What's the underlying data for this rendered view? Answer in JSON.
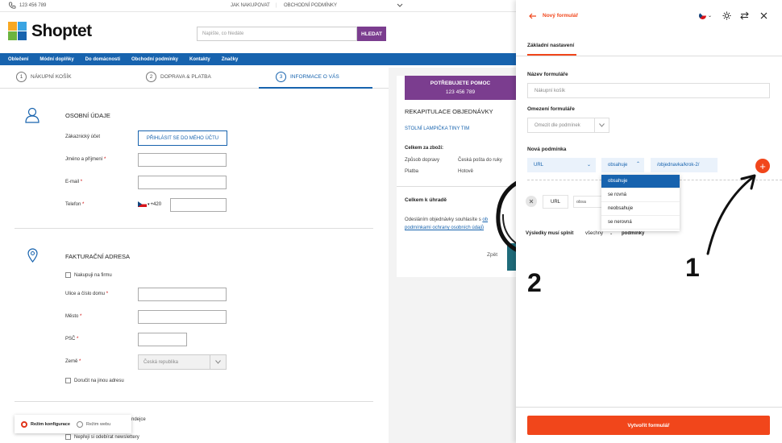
{
  "topbar": {
    "phone": "123 456 789",
    "how_to_buy": "JAK NAKUPOVAT",
    "terms": "OBCHODNÍ PODMÍNKY"
  },
  "brand": {
    "name": "Shoptet"
  },
  "search": {
    "placeholder": "Napište, co hledáte",
    "button": "HLEDAT"
  },
  "nav": [
    "Oblečení",
    "Módní doplňky",
    "Do domácnosti",
    "Obchodní podmínky",
    "Kontakty",
    "Značky"
  ],
  "steps": [
    {
      "num": "1",
      "label": "NÁKUPNÍ KOŠÍK"
    },
    {
      "num": "2",
      "label": "DOPRAVA & PLATBA"
    },
    {
      "num": "3",
      "label": "INFORMACE O VÁS"
    }
  ],
  "personal": {
    "title": "OSOBNÍ ÚDAJE",
    "account_label": "Zákaznický účet",
    "login_button": "PŘIHLÁSIT SE DO MÉHO ÚČTU",
    "name_label": "Jméno a příjmení",
    "email_label": "E-mail",
    "phone_label": "Telefon",
    "phone_prefix": "+420",
    "required": "*"
  },
  "billing": {
    "title": "FAKTURAČNÍ ADRESA",
    "company_cb": "Nakupuji na firmu",
    "street_label": "Ulice a číslo domu",
    "city_label": "Město",
    "zip_label": "PSČ",
    "country_label": "Země",
    "country_value": "Česká republika",
    "other_address_cb": "Doručit na jinou adresu"
  },
  "bottom": {
    "partial_text": "ndejce",
    "newsletter_cb": "Nepřeji si odebírat newslettery"
  },
  "summary": {
    "promo_line1": "POTŘEBUJETE POMOC",
    "promo_line2": "123 456 789",
    "title": "REKAPITULACE OBJEDNÁVKY",
    "product": "STOLNÍ LAMPIČKA TINY TIM",
    "goods_total": "Celkem za zboží:",
    "shipping_label": "Způsob dopravy",
    "shipping_value": "Česká pošta do ruky",
    "payment_label": "Platba",
    "payment_value": "Hotově",
    "total": "Celkem k úhradě",
    "consent_text": "Odesláním objednávky souhlasíte s",
    "consent_link1": "ob",
    "consent_link2": "podmínkami ochrany osobních údajů",
    "back": "Zpět"
  },
  "modes": {
    "config": "Režim konfigurace",
    "web": "Režim webu"
  },
  "panel": {
    "back_icon": "arrow-left-icon",
    "title": "Nový formulář",
    "tab": "Základní nastavení",
    "form_name_label": "Název formuláře",
    "form_name_value": "Nákupní košík",
    "limit_label": "Omezení formuláře",
    "limit_value": "Omezit dle podmínek",
    "new_cond_label": "Nová podmínka",
    "field_value": "URL",
    "op_value": "obsahuje",
    "url_value": "/objednavka/krok-2/",
    "options": [
      "obsahuje",
      "se rovná",
      "neobsahuje",
      "se nerovná"
    ],
    "existing_field": "URL",
    "existing_op": "obsa",
    "result_label": "Výsledky musí splnit",
    "result_value": "všechny",
    "result_suffix": "podmínky",
    "create_button": "Vytvořit formulář",
    "plus": "+"
  },
  "annotations": {
    "one": "1",
    "two": "2"
  },
  "colors": {
    "accent": "#f1461b",
    "brand_blue": "#1763ae",
    "purple": "#7b3d8f"
  }
}
